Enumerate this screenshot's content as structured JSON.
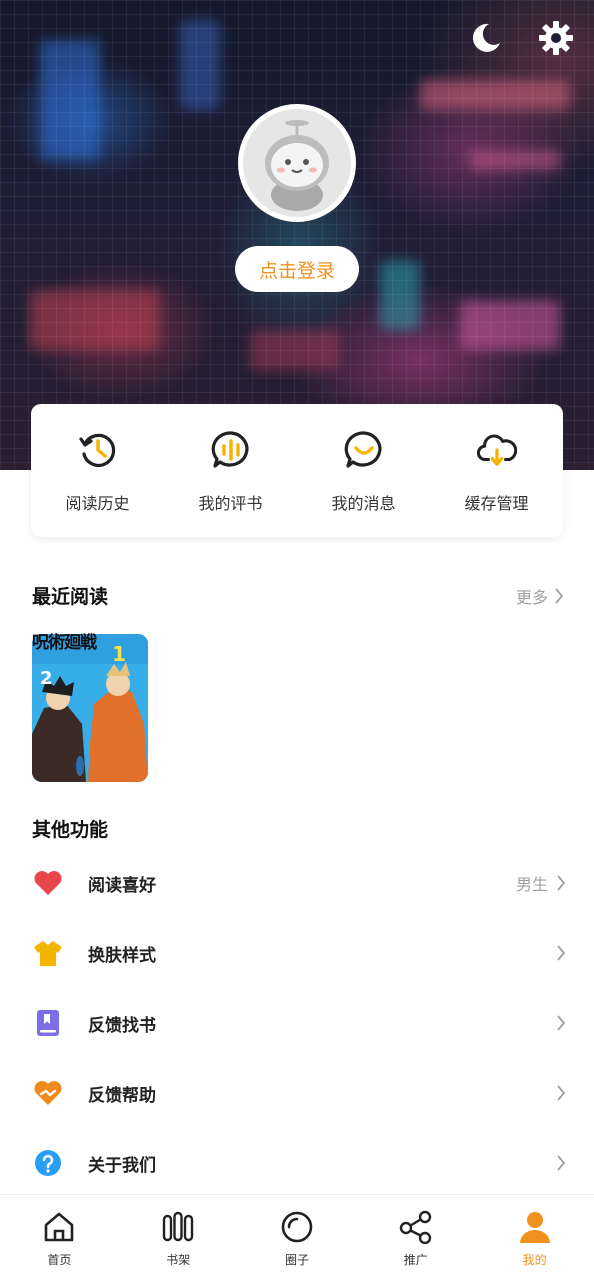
{
  "header": {
    "login_label": "点击登录",
    "top_icons": [
      "moon-icon",
      "gear-icon"
    ]
  },
  "quick_actions": [
    {
      "label": "阅读历史",
      "icon": "history-icon"
    },
    {
      "label": "我的评书",
      "icon": "audio-bubble-icon"
    },
    {
      "label": "我的消息",
      "icon": "message-icon"
    },
    {
      "label": "缓存管理",
      "icon": "cloud-download-icon"
    }
  ],
  "recent": {
    "title": "最近阅读",
    "more_label": "更多",
    "books": [
      {
        "title": "呪術廻戦",
        "cover_numbers": [
          "1",
          "2"
        ]
      }
    ]
  },
  "other": {
    "title": "其他功能",
    "items": [
      {
        "label": "阅读喜好",
        "value": "男生",
        "icon": "heart-icon",
        "color": "#e8474a"
      },
      {
        "label": "换肤样式",
        "value": "",
        "icon": "shirt-icon",
        "color": "#f5b400"
      },
      {
        "label": "反馈找书",
        "value": "",
        "icon": "bookmark-book-icon",
        "color": "#7b6ee6"
      },
      {
        "label": "反馈帮助",
        "value": "",
        "icon": "help-hands-icon",
        "color": "#f08a1c"
      },
      {
        "label": "关于我们",
        "value": "",
        "icon": "question-icon",
        "color": "#2a9df4"
      }
    ]
  },
  "bottom_nav": [
    {
      "label": "首页",
      "icon": "home-icon",
      "active": false
    },
    {
      "label": "书架",
      "icon": "bookshelf-icon",
      "active": false
    },
    {
      "label": "圈子",
      "icon": "circle-icon",
      "active": false
    },
    {
      "label": "推广",
      "icon": "share-icon",
      "active": false
    },
    {
      "label": "我的",
      "icon": "user-icon",
      "active": true
    }
  ],
  "colors": {
    "accent": "#f0901d",
    "icon_yellow": "#f5b400",
    "muted": "#a0a0a0"
  }
}
